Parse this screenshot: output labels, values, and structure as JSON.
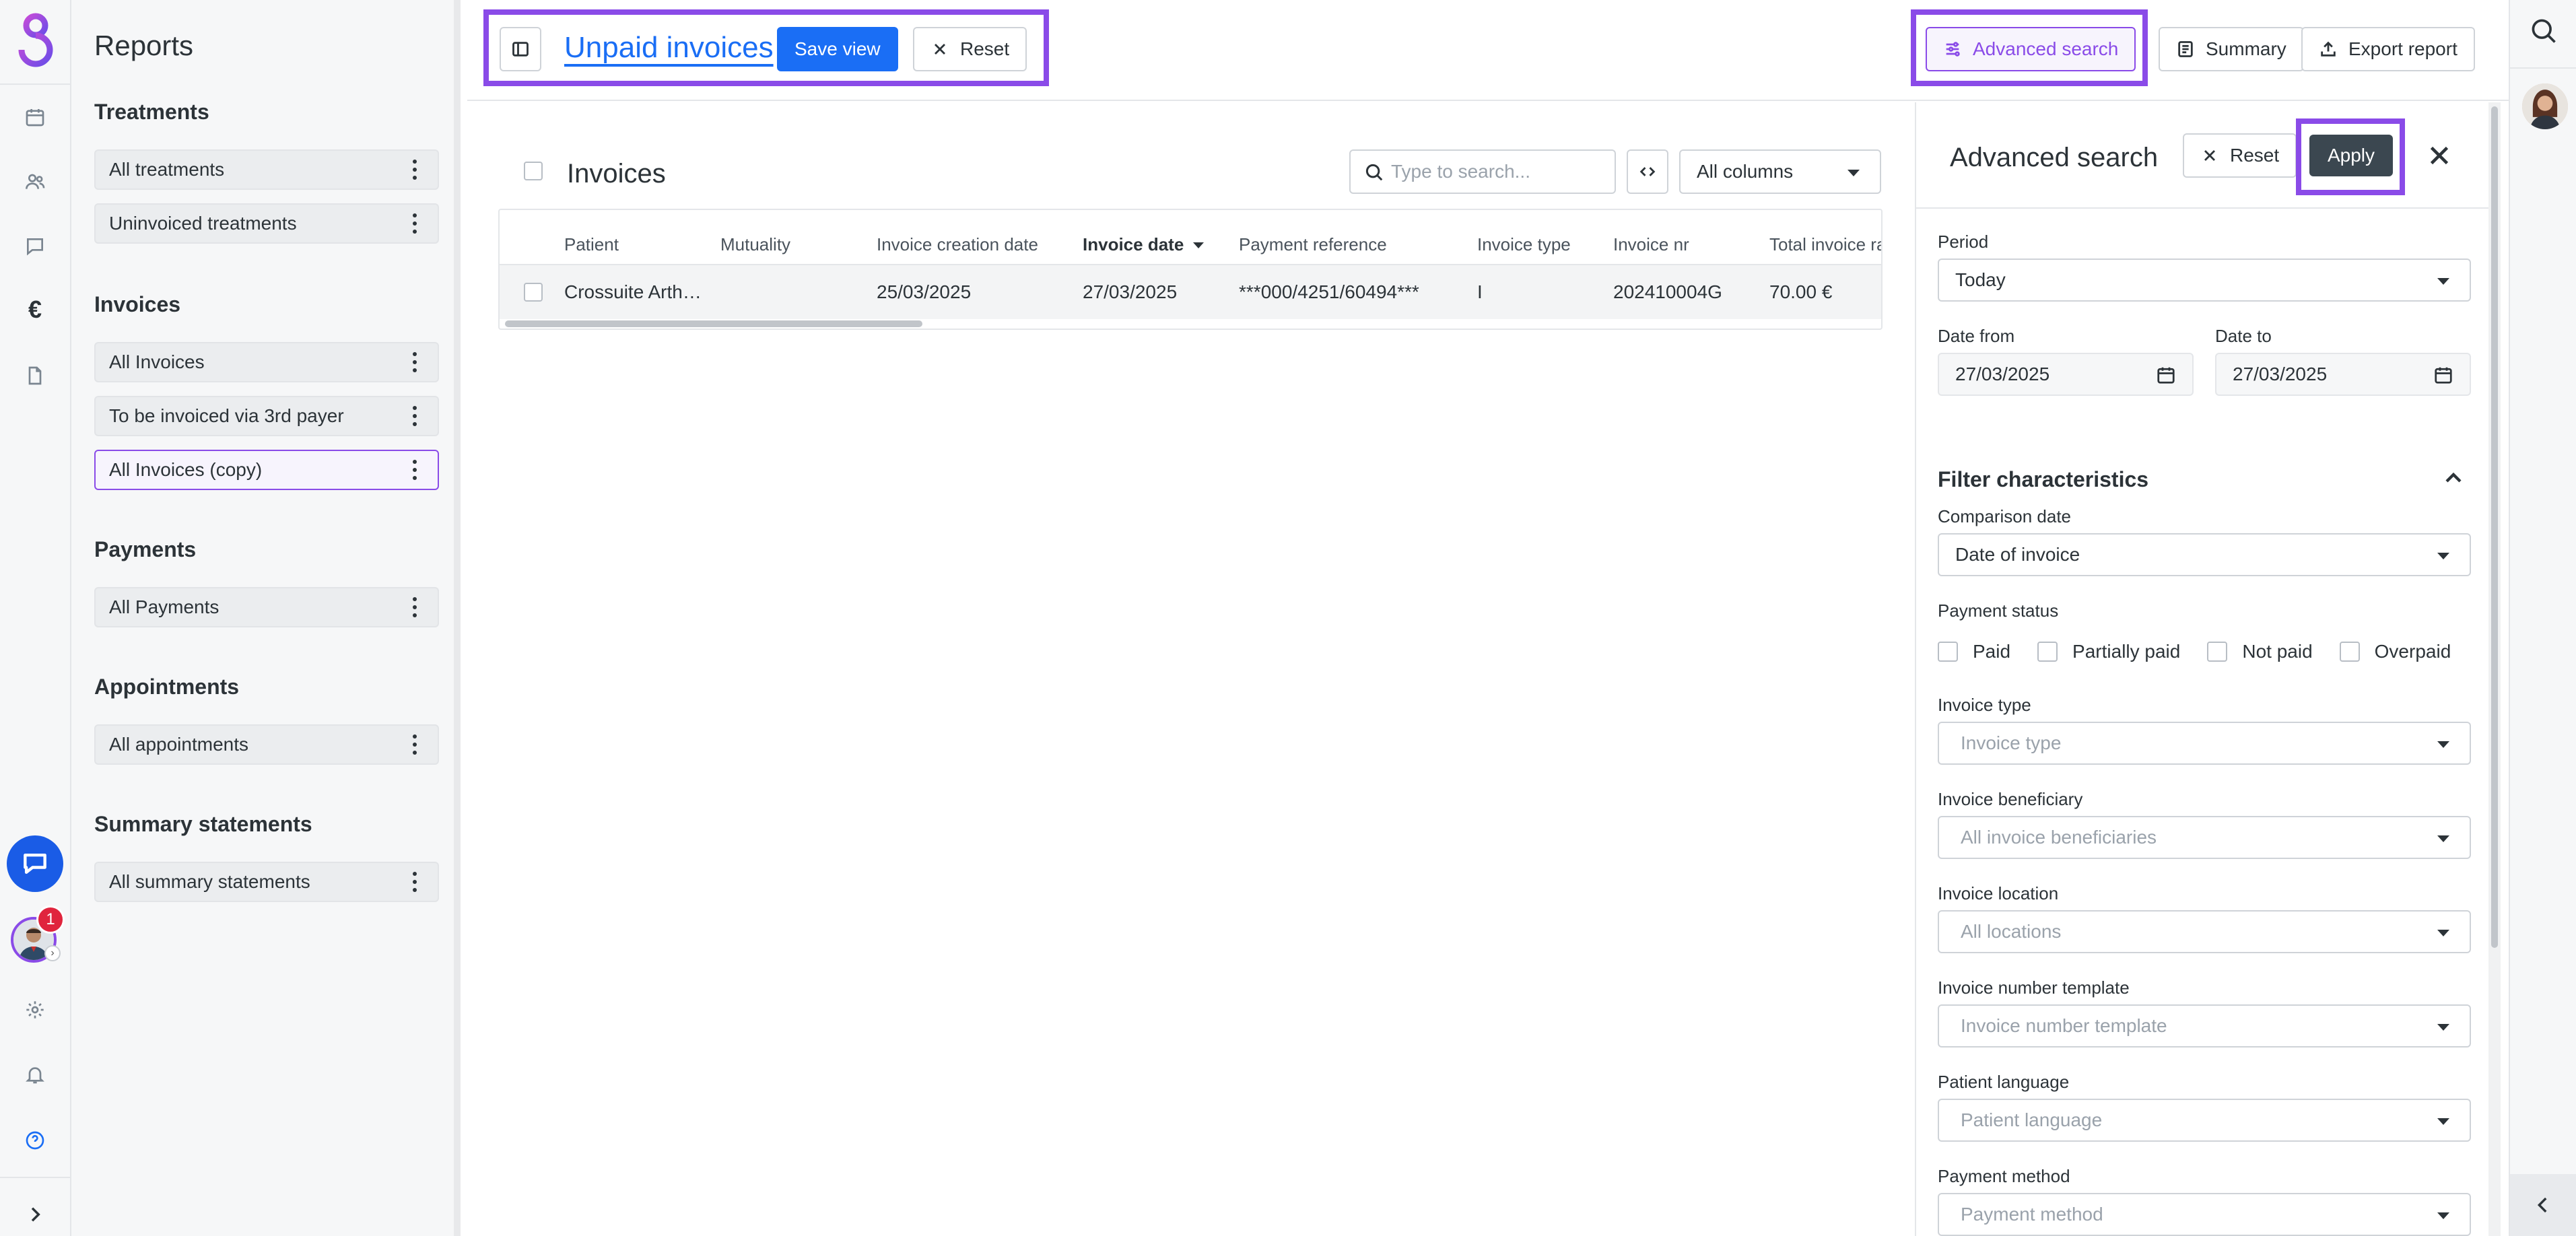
{
  "sidebar": {
    "title": "Reports",
    "sections": [
      {
        "title": "Treatments",
        "items": [
          "All treatments",
          "Uninvoiced treatments"
        ]
      },
      {
        "title": "Invoices",
        "items": [
          "All Invoices",
          "To be invoiced via 3rd payer",
          "All Invoices (copy)"
        ]
      },
      {
        "title": "Payments",
        "items": [
          "All Payments"
        ]
      },
      {
        "title": "Appointments",
        "items": [
          "All appointments"
        ]
      },
      {
        "title": "Summary statements",
        "items": [
          "All summary statements"
        ]
      }
    ],
    "active_item": "All Invoices (copy)"
  },
  "rail": {
    "notification_count": "1",
    "icons": [
      "calendar-icon",
      "patients-icon",
      "messages-icon",
      "euro-icon",
      "document-icon",
      "chat-icon",
      "settings-icon",
      "bell-icon",
      "help-icon",
      "expand-icon"
    ]
  },
  "header": {
    "view_title": "Unpaid invoices",
    "save_view": "Save view",
    "reset": "Reset",
    "advanced_search": "Advanced search",
    "summary": "Summary",
    "export_report": "Export report"
  },
  "table": {
    "title": "Invoices",
    "search_placeholder": "Type to search...",
    "columns_select": "All columns",
    "columns": [
      "Patient",
      "Mutuality",
      "Invoice creation date",
      "Invoice date",
      "Payment reference",
      "Invoice type",
      "Invoice nr",
      "Total invoice ra"
    ],
    "sorted_column": "Invoice date",
    "rows": [
      [
        "Crossuite Arth…",
        "",
        "25/03/2025",
        "27/03/2025",
        "***000/4251/60494***",
        "I",
        "202410004G",
        "70.00 €"
      ]
    ]
  },
  "panel": {
    "title": "Advanced search",
    "reset": "Reset",
    "apply": "Apply",
    "period_label": "Period",
    "period_value": "Today",
    "date_from_label": "Date from",
    "date_from": "27/03/2025",
    "date_to_label": "Date to",
    "date_to": "27/03/2025",
    "filter_title": "Filter characteristics",
    "comparison_label": "Comparison date",
    "comparison_value": "Date of invoice",
    "payment_status_label": "Payment status",
    "payment_status_options": [
      "Paid",
      "Partially paid",
      "Not paid",
      "Overpaid"
    ],
    "invoice_type_label": "Invoice type",
    "invoice_type_placeholder": "Invoice type",
    "beneficiary_label": "Invoice beneficiary",
    "beneficiary_placeholder": "All invoice beneficiaries",
    "location_label": "Invoice location",
    "location_placeholder": "All locations",
    "number_template_label": "Invoice number template",
    "number_template_placeholder": "Invoice number template",
    "patient_language_label": "Patient language",
    "patient_language_placeholder": "Patient language",
    "payment_method_label": "Payment method",
    "payment_method_placeholder": "Payment method"
  },
  "colors": {
    "accent": "#8a4be8",
    "primary": "#1a6ef5",
    "apply_bg": "#3b4750",
    "badge": "#e0243d"
  }
}
